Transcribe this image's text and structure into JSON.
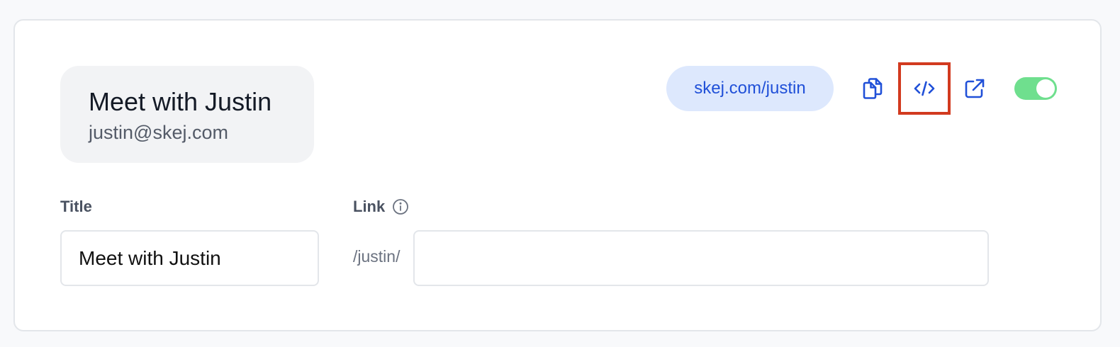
{
  "profile": {
    "name": "Meet with Justin",
    "email": "justin@skej.com"
  },
  "header": {
    "booking_url": "skej.com/justin",
    "actions": [
      {
        "name": "copy-icon"
      },
      {
        "name": "code-embed-icon"
      },
      {
        "name": "external-link-icon"
      }
    ],
    "toggle_on": true
  },
  "form": {
    "title_label": "Title",
    "title_value": "Meet with Justin",
    "link_label": "Link",
    "link_prefix": "/justin/",
    "link_value": ""
  },
  "colors": {
    "accent": "#2050d8",
    "pill_bg": "#dde8fd",
    "toggle_on": "#6fdf8e",
    "highlight": "#d23a1f"
  }
}
